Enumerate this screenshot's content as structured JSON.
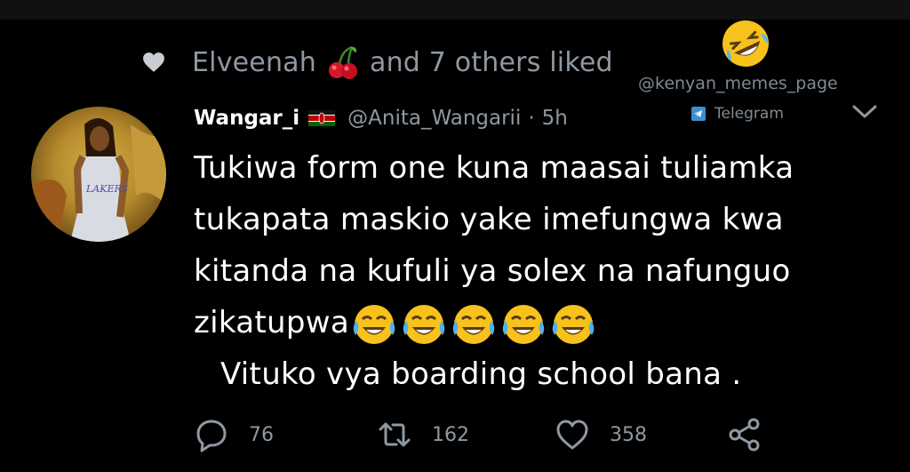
{
  "social_context": {
    "liker_name": "Elveenah",
    "liker_emoji": "cherries-emoji",
    "others_text": "and 7 others liked",
    "icon": "heart-icon"
  },
  "overlay": {
    "reaction_emoji": "rolling-on-floor-laughing-emoji",
    "watermark": "@kenyan_memes_page",
    "telegram_label": "Telegram"
  },
  "tweet": {
    "display_name": "Wangar_i",
    "flag": "kenya-flag",
    "handle": "@Anita_Wangarii",
    "separator": "·",
    "time": "5h",
    "lines": [
      "Tukiwa form one kuna maasai tuliamka",
      "tukapata maskio yake imefungwa kwa",
      "kitanda na kufuli ya solex  na nafunguo",
      "zikatupwa",
      "Vituko vya boarding school bana ."
    ],
    "emoji_count_label": "face-with-tears-of-joy-emoji x5"
  },
  "actions": {
    "reply_count": "76",
    "retweet_count": "162",
    "like_count": "358"
  },
  "colors": {
    "background": "#000000",
    "text": "#ffffff",
    "muted": "#8f98a1"
  }
}
